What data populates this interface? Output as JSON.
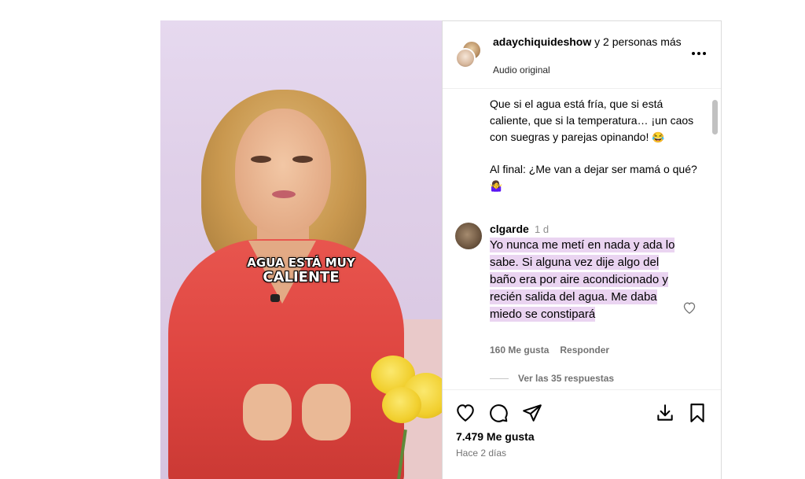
{
  "video": {
    "caption_line1": "AGUA ESTÁ MUY",
    "caption_line2": "CALIENTE"
  },
  "header": {
    "username": "adaychiquideshow",
    "collab_suffix": " y 2 personas más",
    "audio": "Audio original",
    "more_icon": "more-icon"
  },
  "post": {
    "paragraph1": "Que si el agua está fría, que si está caliente, que si la temperatura… ¡un caos con suegras y parejas opinando!",
    "paragraph1_emoji": "😂",
    "paragraph2": "Al final: ¿Me van a dejar ser mamá o qué?",
    "paragraph2_emoji": "🤷‍♀️"
  },
  "comment": {
    "username": "clgarde",
    "time": "1 d",
    "text": "Yo nunca me metí en nada y ada lo sabe. Si alguna vez dije algo del baño era por aire acondicionado y recién salida del agua. Me daba miedo se constipará",
    "likes": "160 Me gusta",
    "reply": "Responder",
    "view_replies": "Ver las 35 respuestas"
  },
  "footer": {
    "likes": "7.479 Me gusta",
    "ago": "Hace 2 días"
  },
  "icons": [
    "heart-icon",
    "comment-icon",
    "share-icon",
    "download-icon",
    "bookmark-icon"
  ],
  "colors": {
    "highlight": "#ead4f1",
    "dress": "#de4540",
    "meta_text": "#737373"
  }
}
